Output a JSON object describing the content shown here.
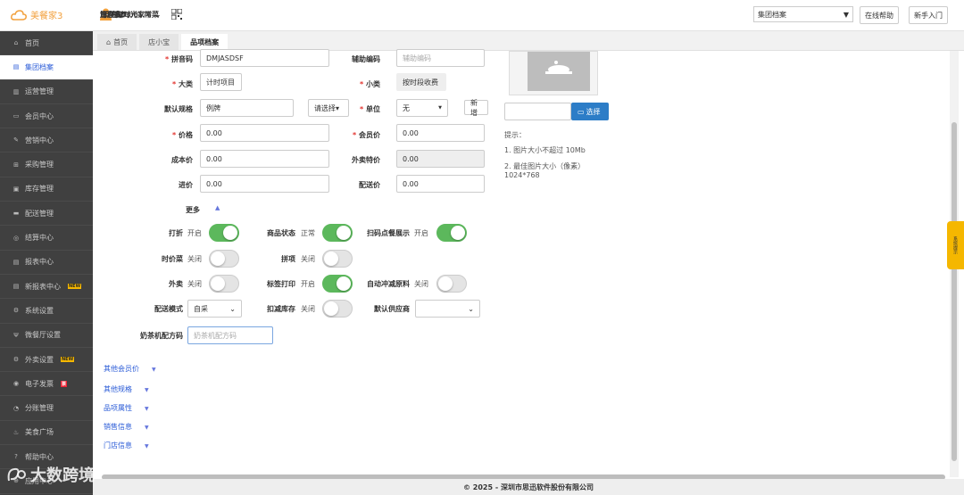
{
  "header": {
    "brand": "美餐家3",
    "user_label": "用户名：",
    "user_name": "管理员",
    "merchant_label": "商户ID：",
    "merchant_id": "32000176",
    "store_name": "随刻时光家常菜",
    "dept_select": "集团档案",
    "online_help": "在线帮助",
    "newbie": "新手入门"
  },
  "sidebar": {
    "items": [
      {
        "label": "首页",
        "icon": "home-icon"
      },
      {
        "label": "集团档案",
        "icon": "document-icon",
        "active": true
      },
      {
        "label": "运营管理",
        "icon": "chart-icon"
      },
      {
        "label": "会员中心",
        "icon": "card-icon"
      },
      {
        "label": "营销中心",
        "icon": "edit-icon"
      },
      {
        "label": "采购管理",
        "icon": "cart-icon"
      },
      {
        "label": "库存管理",
        "icon": "box-icon"
      },
      {
        "label": "配送管理",
        "icon": "truck-icon"
      },
      {
        "label": "结算中心",
        "icon": "coin-icon"
      },
      {
        "label": "报表中心",
        "icon": "report-icon"
      },
      {
        "label": "新报表中心",
        "icon": "new-report-icon",
        "badge": "NEW"
      },
      {
        "label": "系统设置",
        "icon": "gear-icon"
      },
      {
        "label": "微餐厅设置",
        "icon": "fork-icon"
      },
      {
        "label": "外卖设置",
        "icon": "gear-icon",
        "badge": "NEW"
      },
      {
        "label": "电子发票",
        "icon": "invoice-icon",
        "badge": "票",
        "badge_red": true
      },
      {
        "label": "分账管理",
        "icon": "split-icon"
      },
      {
        "label": "美食广场",
        "icon": "food-icon"
      },
      {
        "label": "帮助中心",
        "icon": "help-icon"
      },
      {
        "label": "应用中心",
        "icon": "app-icon"
      }
    ]
  },
  "tabs": [
    {
      "label": "首页",
      "icon": "home-icon"
    },
    {
      "label": "店小宝"
    },
    {
      "label": "品项档案",
      "active": true
    }
  ],
  "form": {
    "pinyin_label": "拼音码",
    "pinyin_value": "DMJASDSF",
    "aux_label": "辅助编码",
    "aux_placeholder": "辅助编码",
    "category_label": "大类",
    "category_value": "计时项目",
    "subcategory_label": "小类",
    "subcategory_value": "按时段收费",
    "spec_label": "默认规格",
    "spec_value": "例牌",
    "spec_select_btn": "请选择▾",
    "unit_label": "单位",
    "unit_value": "无",
    "new_btn": "新增",
    "price_label": "价格",
    "price_value": "0.00",
    "member_price_label": "会员价",
    "member_price_value": "0.00",
    "cost_label": "成本价",
    "cost_value": "0.00",
    "takeout_price_label": "外卖特价",
    "takeout_price_value": "0.00",
    "purchase_label": "进价",
    "purchase_value": "0.00",
    "delivery_label": "配送价",
    "delivery_value": "0.00",
    "more_label": "更多",
    "discount_label": "打折",
    "discount_status": "开启",
    "item_status_label": "商品状态",
    "item_status_value": "正常",
    "scan_label": "扫码点餐展示",
    "scan_status": "开启",
    "seasonal_label": "时价菜",
    "seasonal_status": "关闭",
    "lisd_label": "拼项",
    "lisd_status": "关闭",
    "takeout_label": "外卖",
    "takeout_status": "关闭",
    "label_print_label": "标签打印",
    "label_print_status": "开启",
    "auto_reduce_label": "自动冲减原料",
    "auto_reduce_status": "关闭",
    "delivery_mode_label": "配送模式",
    "delivery_mode_value": "自采",
    "deduct_stock_label": "扣减库存",
    "deduct_stock_status": "关闭",
    "default_supplier_label": "默认供应商",
    "tea_label": "奶茶机配方码",
    "tea_placeholder": "奶茶机配方码"
  },
  "image_panel": {
    "choose_btn": "选择",
    "hint_title": "提示：",
    "hint_1": "1. 图片大小不超过 10Mb",
    "hint_2": "2. 最佳图片大小（像素）",
    "hint_3": "1024*768"
  },
  "sections": [
    "其他会员价",
    "其他规格",
    "品项属性",
    "销售信息",
    "门店信息"
  ],
  "side_tip": "系统提示",
  "footer": "© 2025 - 深圳市思迅软件股份有限公司",
  "watermark": "大数跨境"
}
